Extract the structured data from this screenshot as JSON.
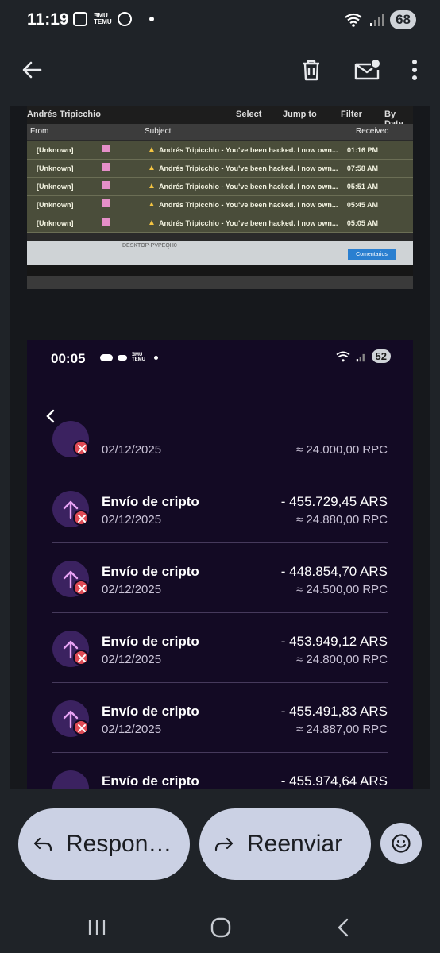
{
  "status_bar": {
    "time": "11:19",
    "temu": "ƎMU\nTEMU",
    "battery": "68"
  },
  "embedded_photo": {
    "sender": "Andrés Tripicchio",
    "toolbar_select": "Select",
    "toolbar_jump": "Jump to",
    "toolbar_filter": "Filter",
    "toolbar_sort": "By Date",
    "col_from": "From",
    "col_subject": "Subject",
    "col_received": "Received",
    "rows": [
      {
        "from": "[Unknown]",
        "subject": "Andrés Tripicchio - You've been hacked. I now own...",
        "time": "01:16 PM"
      },
      {
        "from": "[Unknown]",
        "subject": "Andrés Tripicchio - You've been hacked. I now own...",
        "time": "07:58 AM"
      },
      {
        "from": "[Unknown]",
        "subject": "Andrés Tripicchio - You've been hacked. I now own...",
        "time": "05:51 AM"
      },
      {
        "from": "[Unknown]",
        "subject": "Andrés Tripicchio - You've been hacked. I now own...",
        "time": "05:45 AM"
      },
      {
        "from": "[Unknown]",
        "subject": "Andrés Tripicchio - You've been hacked. I now own...",
        "time": "05:05 AM"
      }
    ],
    "desktop_label": "DESKTOP-PVPEQH0",
    "comment_button": "Comentarios"
  },
  "embedded_screenshot": {
    "time": "00:05",
    "battery": "52",
    "transactions": [
      {
        "title": "",
        "date": "02/12/2025",
        "ars": "",
        "rpc": "≈ 24.000,00 RPC"
      },
      {
        "title": "Envío de cripto",
        "date": "02/12/2025",
        "ars": "- 455.729,45 ARS",
        "rpc": "≈ 24.880,00 RPC"
      },
      {
        "title": "Envío de cripto",
        "date": "02/12/2025",
        "ars": "- 448.854,70 ARS",
        "rpc": "≈ 24.500,00 RPC"
      },
      {
        "title": "Envío de cripto",
        "date": "02/12/2025",
        "ars": "- 453.949,12 ARS",
        "rpc": "≈ 24.800,00 RPC"
      },
      {
        "title": "Envío de cripto",
        "date": "02/12/2025",
        "ars": "- 455.491,83 ARS",
        "rpc": "≈ 24.887,00 RPC"
      },
      {
        "title": "Envío de cripto",
        "date": "",
        "ars": "- 455.974,64 ARS",
        "rpc": ""
      }
    ]
  },
  "actions": {
    "reply_label": "Respon…",
    "forward_label": "Reenviar"
  },
  "icons": {
    "back": "arrow-left-icon",
    "delete": "trash-icon",
    "unread": "mail-unread-icon",
    "more": "more-vert-icon",
    "reply": "reply-icon",
    "forward": "forward-icon",
    "emoji": "emoji-icon"
  }
}
